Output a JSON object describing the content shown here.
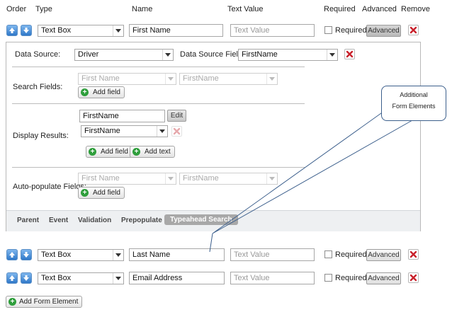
{
  "headers": {
    "order": "Order",
    "type": "Type",
    "name": "Name",
    "text_value": "Text Value",
    "required": "Required",
    "advanced": "Advanced",
    "remove": "Remove"
  },
  "rows": [
    {
      "type": "Text Box",
      "name": "First Name",
      "text_value_placeholder": "Text Value",
      "required_label": "Required",
      "required": false,
      "advanced_label": "Advanced",
      "advanced_active": true
    },
    {
      "type": "Text Box",
      "name": "Last Name",
      "text_value_placeholder": "Text Value",
      "required_label": "Required",
      "required": false,
      "advanced_label": "Advanced",
      "advanced_active": false
    },
    {
      "type": "Text Box",
      "name": "Email Address",
      "text_value_placeholder": "Text Value",
      "required_label": "Required",
      "required": false,
      "advanced_label": "Advanced",
      "advanced_active": false
    }
  ],
  "panel": {
    "data_source_label": "Data Source:",
    "data_source_value": "Driver",
    "data_source_field_label": "Data Source Field:",
    "data_source_field_value": "FirstName",
    "search_fields_label": "Search Fields:",
    "search_select_1": "First Name",
    "search_select_2": "FirstName",
    "add_field_label": "Add field",
    "display_results_label": "Display Results:",
    "display_input_value": "FirstName",
    "edit_label": "Edit",
    "display_select_value": "FirstName",
    "add_text_label": "Add text",
    "autopop_label": "Auto-populate Fields:",
    "autopop_select_1": "First Name",
    "autopop_select_2": "FirstName"
  },
  "tabs": [
    "Parent",
    "Event",
    "Validation",
    "Prepopulate",
    "Typeahead Search"
  ],
  "active_tab": "Typeahead Search",
  "callout": {
    "line1": "Additional",
    "line2": "Form Elements"
  },
  "add_form_element_label": "Add Form Element",
  "colors": {
    "accent_blue": "#2f78c8",
    "remove_red": "#c8202a",
    "add_green": "#2e9e3b"
  }
}
